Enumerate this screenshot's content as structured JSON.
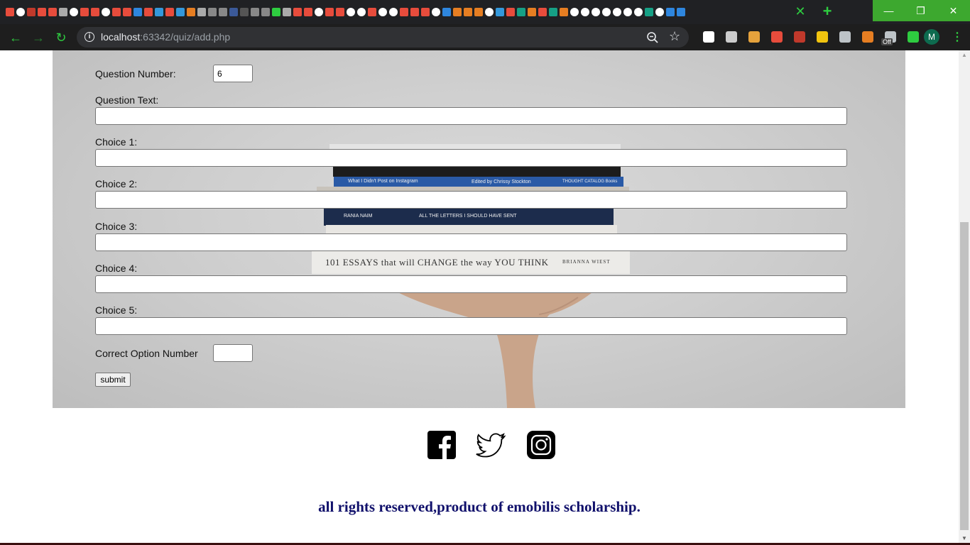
{
  "browser": {
    "url_host": "localhost",
    "url_rest": ":63342/quiz/add.php",
    "profile_initial": "M",
    "extension_badge": "Off",
    "tab_icon_colors": [
      "#e74c3c",
      "#ffffff",
      "#c0392b",
      "#e74c3c",
      "#e74c3c",
      "#aaaaaa",
      "#ffffff",
      "#e74c3c",
      "#e74c3c",
      "#ffffff",
      "#e74c3c",
      "#e74c3c",
      "#2e86de",
      "#e74c3c",
      "#3498db",
      "#e74c3c",
      "#3498db",
      "#e67e22",
      "#aaaaaa",
      "#888888",
      "#888888",
      "#3b5998",
      "#555555",
      "#888888",
      "#888888",
      "#2ecc40",
      "#aaaaaa",
      "#e74c3c",
      "#e74c3c",
      "#ffffff",
      "#e74c3c",
      "#e74c3c",
      "#ffffff",
      "#ffffff",
      "#e74c3c",
      "#ffffff",
      "#ffffff",
      "#e74c3c",
      "#e74c3c",
      "#e74c3c",
      "#ffffff",
      "#2e86de",
      "#e67e22",
      "#e67e22",
      "#e67e22",
      "#ffffff",
      "#3498db",
      "#e74c3c",
      "#16a085",
      "#e67e22",
      "#e74c3c",
      "#16a085",
      "#e67e22",
      "#ffffff",
      "#ffffff",
      "#ffffff",
      "#ffffff",
      "#ffffff",
      "#ffffff",
      "#ffffff",
      "#16a085",
      "#ffffff",
      "#2e86de",
      "#2e86de"
    ],
    "extension_colors": [
      "#ffffff",
      "#cccccc",
      "#e6a23c",
      "#e74c3c",
      "#c0392b",
      "#f1c40f",
      "#bdc3c7",
      "#e67e22",
      "#bdc3c7",
      "#2ecc40"
    ]
  },
  "form": {
    "question_number_label": "Question Number:",
    "question_number_value": "6",
    "question_text_label": "Question Text:",
    "choice_1_label": "Choice 1:",
    "choice_2_label": "Choice 2:",
    "choice_3_label": "Choice 3:",
    "choice_4_label": "Choice 4:",
    "choice_5_label": "Choice 5:",
    "correct_option_label": "Correct Option Number",
    "correct_option_value": "",
    "submit_label": "submit"
  },
  "hero_books": {
    "book_c_left": "What I Didn't Post on Instagram",
    "book_c_mid": "Edited by Chrissy Stockton",
    "book_c_right": "THOUGHT CATALOG Books",
    "book_e_left": "RANIA NAIM",
    "book_e_mid": "ALL THE LETTERS I SHOULD HAVE SENT",
    "book_g_title": "101 ESSAYS that will CHANGE the way YOU THINK",
    "book_g_author": "BRIANNA WIEST"
  },
  "footer": {
    "copyright": "all rights reserved,product of emobilis scholarship."
  }
}
